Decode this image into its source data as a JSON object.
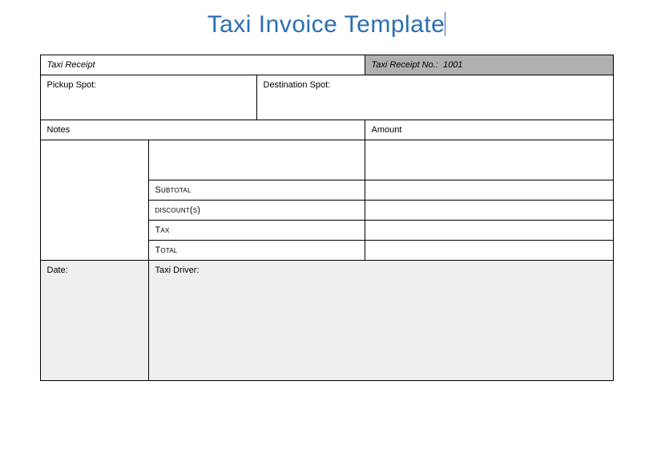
{
  "title": "Taxi Invoice Template",
  "header": {
    "receipt_label": "Taxi Receipt",
    "receipt_no_label": "Taxi Receipt No.:",
    "receipt_no_value": "1001"
  },
  "spots": {
    "pickup_label": "Pickup Spot:",
    "destination_label": "Destination Spot:"
  },
  "columns": {
    "notes": "Notes",
    "amount": "Amount"
  },
  "lines": {
    "subtotal": "Subtotal",
    "discounts": "discount(s)",
    "tax": "Tax",
    "total": "Total"
  },
  "footer": {
    "date_label": "Date:",
    "driver_label": "Taxi Driver:"
  }
}
